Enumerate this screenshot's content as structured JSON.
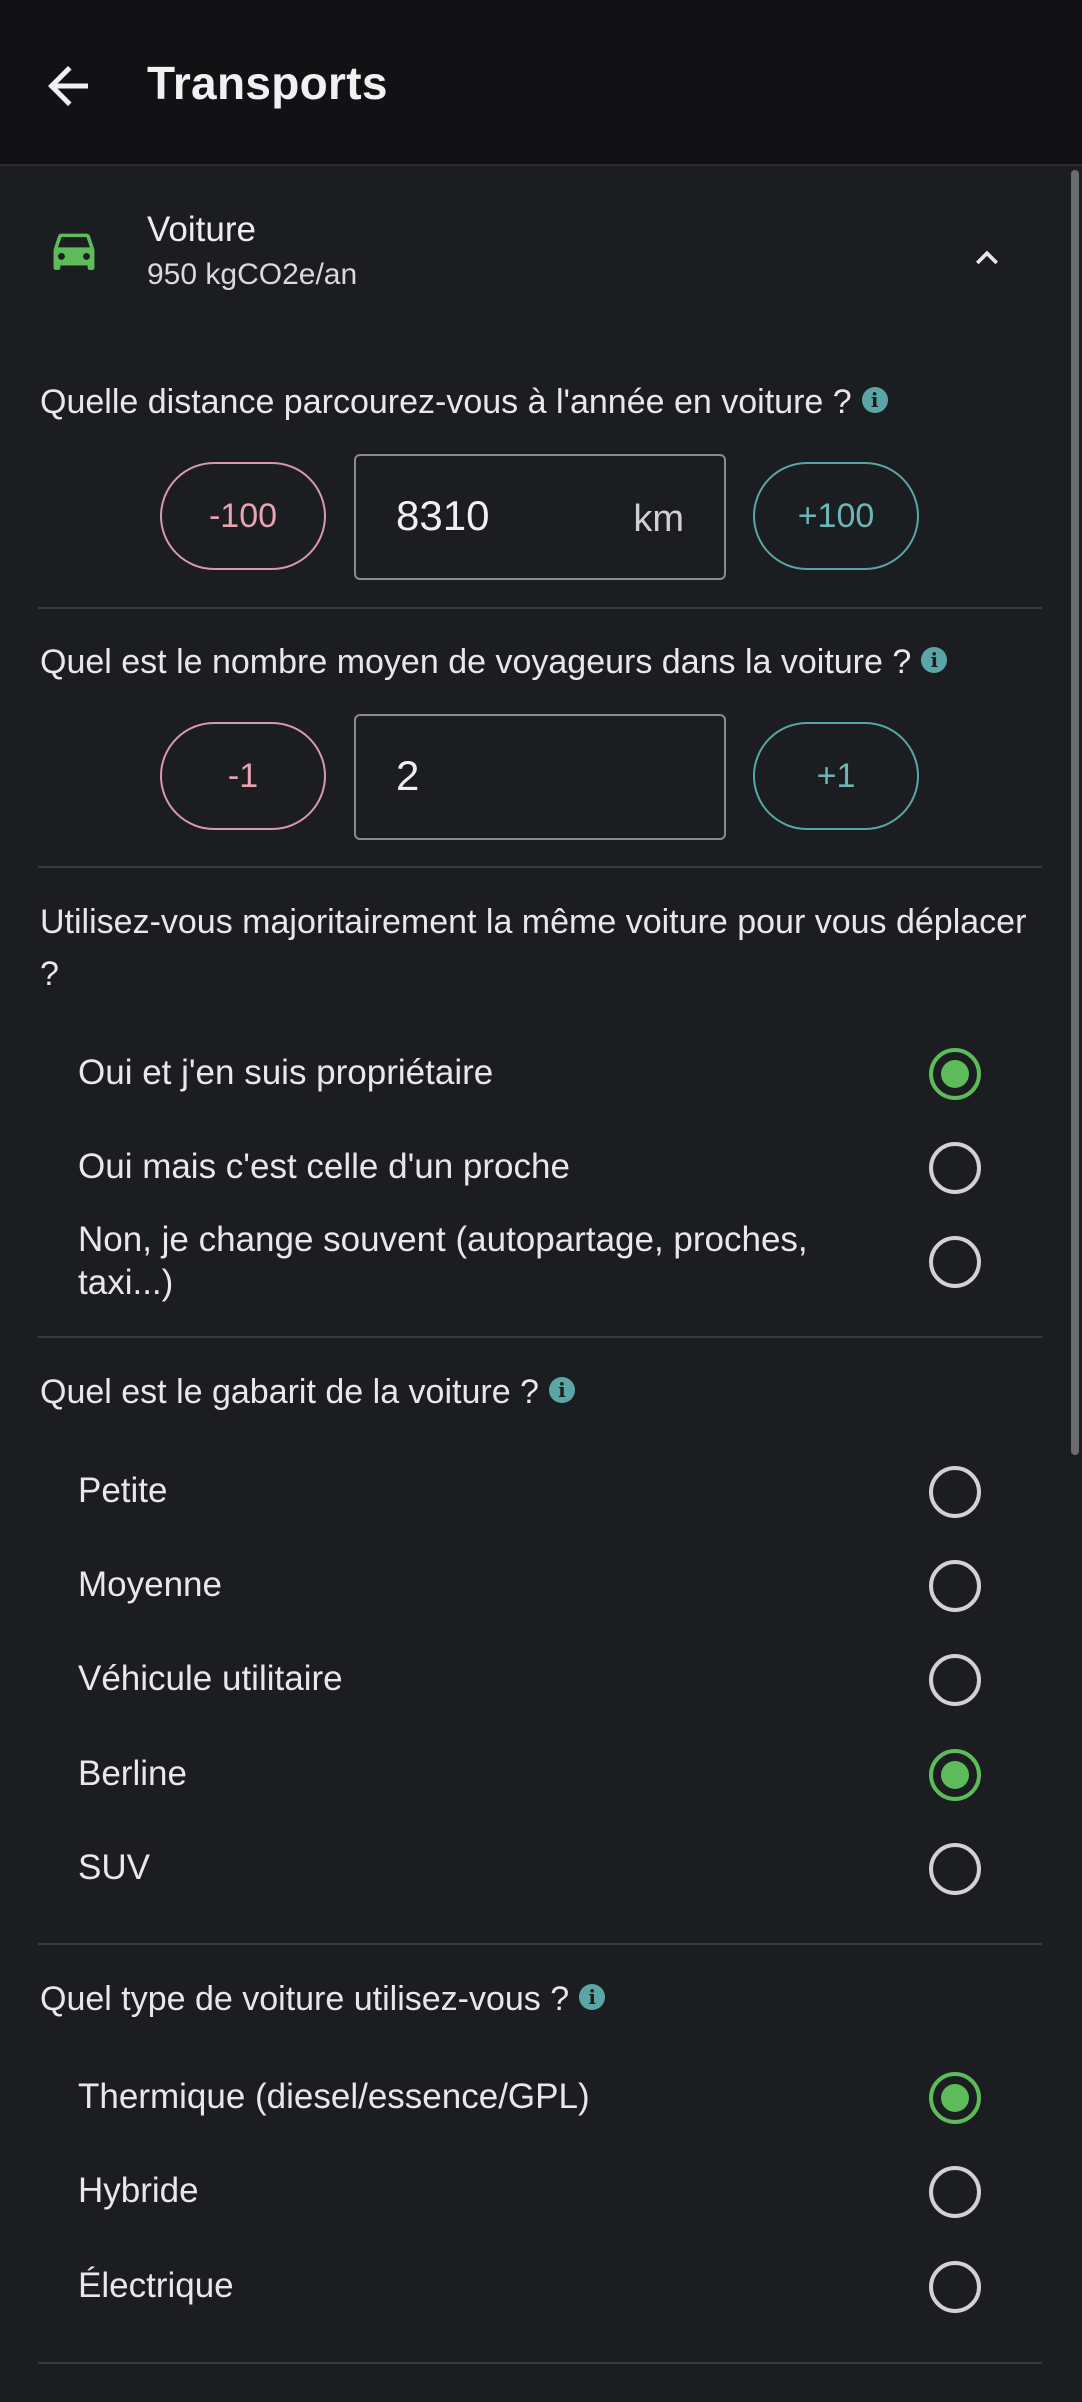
{
  "appbar": {
    "title": "Transports"
  },
  "car": {
    "title": "Voiture",
    "subtitle": "950 kgCO2e/an"
  },
  "distance": {
    "question": "Quelle distance parcourez-vous à l'année en voiture ?",
    "minus_label": "-100",
    "plus_label": "+100",
    "value": "8310",
    "unit": "km"
  },
  "passengers": {
    "question": "Quel est le nombre moyen de voyageurs dans la voiture ?",
    "minus_label": "-1",
    "plus_label": "+1",
    "value": "2"
  },
  "same_car": {
    "question": "Utilisez-vous majoritairement la même voiture pour vous déplacer ?",
    "options": [
      {
        "label": "Oui et j'en suis propriétaire",
        "selected": true
      },
      {
        "label": "Oui mais c'est celle d'un proche",
        "selected": false
      },
      {
        "label": "Non, je change souvent (autopartage, proches, taxi...)",
        "selected": false
      }
    ]
  },
  "size": {
    "question": "Quel est le gabarit de la voiture ?",
    "options": [
      {
        "label": "Petite",
        "selected": false
      },
      {
        "label": "Moyenne",
        "selected": false
      },
      {
        "label": "Véhicule utilitaire",
        "selected": false
      },
      {
        "label": "Berline",
        "selected": true
      },
      {
        "label": "SUV",
        "selected": false
      }
    ]
  },
  "type": {
    "question": "Quel type de voiture utilisez-vous ?",
    "options": [
      {
        "label": "Thermique (diesel/essence/GPL)",
        "selected": true
      },
      {
        "label": "Hybride",
        "selected": false
      },
      {
        "label": "Électrique",
        "selected": false
      }
    ]
  },
  "colors": {
    "accent_green": "#5dbb5a",
    "teal": "#5aa6a6",
    "pink": "#d99aa8",
    "background": "#1c1d21"
  }
}
